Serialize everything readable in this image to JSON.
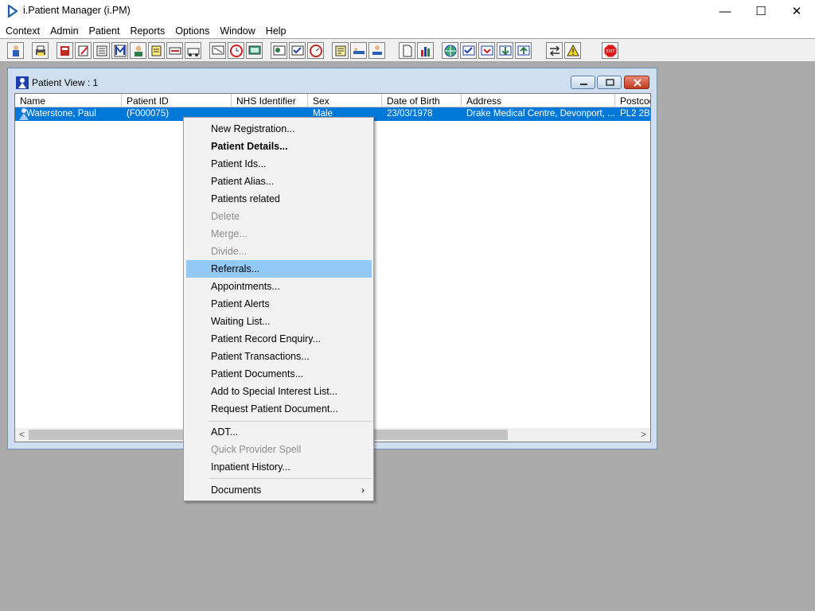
{
  "app": {
    "title": "i.Patient Manager (i.PM)",
    "controls": {
      "minimize": "—",
      "maximize": "☐",
      "close": "✕"
    }
  },
  "menubar": [
    "Context",
    "Admin",
    "Patient",
    "Reports",
    "Options",
    "Window",
    "Help"
  ],
  "toolbar": {
    "buttons": [
      {
        "icon": "patient-search-icon"
      },
      {
        "icon": "printer-icon"
      },
      {
        "icon": "book-icon"
      },
      {
        "icon": "edit-form-icon"
      },
      {
        "icon": "document-list-icon"
      },
      {
        "icon": "m-letter-icon"
      },
      {
        "icon": "person-icon"
      },
      {
        "icon": "notepad-icon"
      },
      {
        "icon": "transfer-icon"
      },
      {
        "icon": "ambulance-icon"
      },
      {
        "icon": "monitor-icon"
      },
      {
        "icon": "clock-icon"
      },
      {
        "icon": "screen-icon"
      },
      {
        "icon": "chart-board-icon"
      },
      {
        "icon": "form-check-icon"
      },
      {
        "icon": "dial-icon"
      },
      {
        "icon": "note-icon"
      },
      {
        "icon": "bed-icon"
      },
      {
        "icon": "ward-icon"
      },
      {
        "icon": "blank-page-icon"
      },
      {
        "icon": "bar-chart-icon"
      },
      {
        "icon": "globe-icon"
      },
      {
        "icon": "list-check-icon"
      },
      {
        "icon": "list-arrow-icon"
      },
      {
        "icon": "list-down-icon"
      },
      {
        "icon": "list-up-icon"
      },
      {
        "icon": "swap-icon"
      },
      {
        "icon": "warning-icon"
      },
      {
        "icon": "exit-icon"
      }
    ],
    "exit_label": "EXIT"
  },
  "colors": {
    "selection": "#0078d7",
    "menu_highlight": "#91c9f7",
    "workspace": "#ababab"
  },
  "patient_view": {
    "title": "Patient View : 1",
    "columns": [
      "Name",
      "Patient ID",
      "NHS Identifier",
      "Sex",
      "Date of Birth",
      "Address",
      "Postcod"
    ],
    "rows": [
      {
        "name": "Waterstone, Paul",
        "patient_id": "(F000075)",
        "nhs_identifier": "",
        "sex": "Male",
        "date_of_birth": "23/03/1978",
        "address": "Drake Medical Centre, Devonport, ...",
        "postcode": "PL2 2B"
      }
    ]
  },
  "context_menu": {
    "items": [
      {
        "label": "New Registration...",
        "state": "normal"
      },
      {
        "label": "Patient Details...",
        "state": "bold"
      },
      {
        "label": "Patient Ids...",
        "state": "normal"
      },
      {
        "label": "Patient Alias...",
        "state": "normal"
      },
      {
        "label": "Patients related",
        "state": "normal"
      },
      {
        "label": "Delete",
        "state": "disabled"
      },
      {
        "label": "Merge...",
        "state": "disabled"
      },
      {
        "label": "Divide...",
        "state": "disabled"
      },
      {
        "label": "Referrals...",
        "state": "highlighted"
      },
      {
        "label": "Appointments...",
        "state": "normal"
      },
      {
        "label": "Patient Alerts",
        "state": "normal"
      },
      {
        "label": "Waiting List...",
        "state": "normal"
      },
      {
        "label": "Patient Record Enquiry...",
        "state": "normal"
      },
      {
        "label": "Patient Transactions...",
        "state": "normal"
      },
      {
        "label": "Patient Documents...",
        "state": "normal"
      },
      {
        "label": "Add to Special Interest List...",
        "state": "normal"
      },
      {
        "label": "Request Patient Document...",
        "state": "normal"
      },
      {
        "label": "ADT...",
        "state": "normal"
      },
      {
        "label": "Quick Provider Spell",
        "state": "disabled"
      },
      {
        "label": "Inpatient History...",
        "state": "normal"
      },
      {
        "label": "Documents",
        "state": "normal",
        "submenu": true
      }
    ],
    "submenu_arrow": "›"
  }
}
